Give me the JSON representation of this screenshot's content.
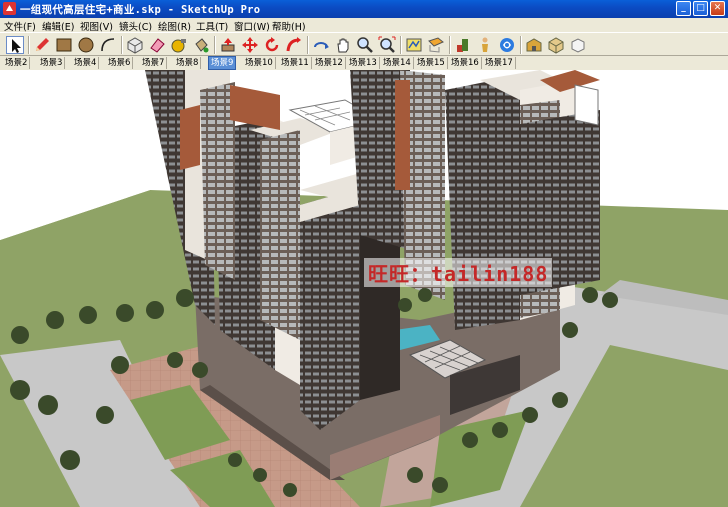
{
  "window": {
    "title": "一组现代高层住宅+商业.skp - SketchUp Pro",
    "buttons": {
      "minimize": "_",
      "maximize": "□",
      "close": "✕"
    }
  },
  "menu": [
    "文件(F)",
    "编辑(E)",
    "视图(V)",
    "镜头(C)",
    "绘图(R)",
    "工具(T)",
    "窗口(W)",
    "帮助(H)"
  ],
  "toolbar": {
    "icons": [
      "select-icon",
      "pencil-icon",
      "rectangle-icon",
      "circle-icon",
      "arc-icon",
      "make-component-icon",
      "eraser-icon",
      "tape-measure-icon",
      "paint-bucket-icon",
      "push-pull-icon",
      "move-icon",
      "rotate-icon",
      "follow-me-icon",
      "orbit-icon",
      "pan-icon",
      "zoom-icon",
      "zoom-extents-icon",
      "sandbox-icon",
      "section-plane-icon",
      "walk-icon",
      "look-around-icon",
      "position-camera-icon",
      "warehouse-icon",
      "components-icon",
      "extension-icon"
    ]
  },
  "scene_tabs": {
    "items": [
      "场景2",
      "场景3",
      "场景4",
      "场景6",
      "场景7",
      "场景8",
      "场景9",
      "场景10",
      "场景11",
      "场景12",
      "场景13",
      "场景14",
      "场景15",
      "场景16",
      "场景17"
    ],
    "active": "场景9"
  },
  "viewport": {
    "watermark": "旺旺：tailin188",
    "colors": {
      "sky": "#ffffff",
      "grass": "#8fa366",
      "road": "#c8c8c8",
      "tower_dark": "#3f3733",
      "tower_light": "#e9e4dc",
      "plaza": "#c69a88"
    }
  }
}
